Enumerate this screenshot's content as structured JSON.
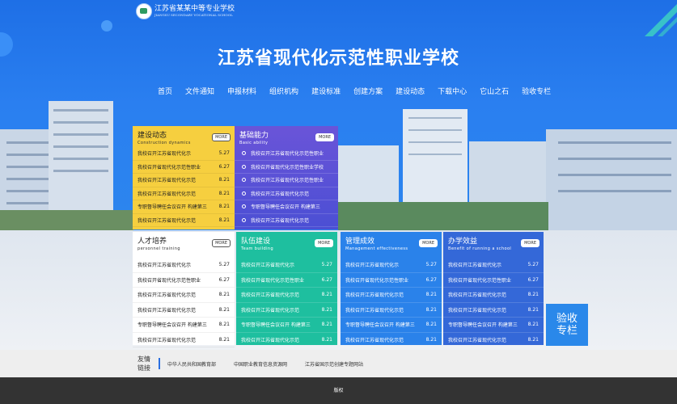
{
  "header": {
    "logo_text": "江苏省某某中等专业学校",
    "logo_sub": "JIANGSU SECONDARY VOCATIONAL SCHOOL",
    "title": "江苏省现代化示范性职业学校"
  },
  "nav": [
    "首页",
    "文件通知",
    "申报材料",
    "组织机构",
    "建设标准",
    "创建方案",
    "建设动态",
    "下载中心",
    "它山之石",
    "验收专栏"
  ],
  "more_label": "MORE",
  "panels": {
    "jianshe": {
      "title": "建设动态",
      "subtitle": "Construction dynamics",
      "items": [
        {
          "text": "我校召开江苏省现代化示",
          "date": "5.27"
        },
        {
          "text": "我校召开省现代化示范性职业",
          "date": "6.27"
        },
        {
          "text": "我校召开江苏省现代化示范",
          "date": "8.21"
        },
        {
          "text": "我校召开江苏省现代化示范",
          "date": "8.21"
        },
        {
          "text": "专职督导聘任会议召开 构建第三",
          "date": "8.21"
        },
        {
          "text": "我校召开江苏省现代化示范",
          "date": "8.21"
        }
      ]
    },
    "jichu": {
      "title": "基础能力",
      "subtitle": "Basic ability",
      "items": [
        "我校召开江苏省现代化示范性职业",
        "我校召开省现代化示范性职业学校",
        "我校召开江苏省现代化示范性职业",
        "我校召开江苏省现代化示范",
        "专职督导聘任会议召开 构建第三",
        "我校召开江苏省现代化示范"
      ]
    },
    "rencai": {
      "title": "人才培养",
      "subtitle": "personnel training",
      "items": [
        {
          "text": "我校召开江苏省现代化示",
          "date": "5.27"
        },
        {
          "text": "我校召开省现代化示范性职业",
          "date": "6.27"
        },
        {
          "text": "我校召开江苏省现代化示范",
          "date": "8.21"
        },
        {
          "text": "我校召开江苏省现代化示范",
          "date": "8.21"
        },
        {
          "text": "专职督导聘任会议召开 构建第三",
          "date": "8.21"
        },
        {
          "text": "我校召开江苏省现代化示范",
          "date": "8.21"
        }
      ]
    },
    "duiwu": {
      "title": "队伍建设",
      "subtitle": "Team building",
      "items": [
        {
          "text": "我校召开江苏省现代化示",
          "date": "5.27"
        },
        {
          "text": "我校召开省现代化示范性职业",
          "date": "6.27"
        },
        {
          "text": "我校召开江苏省现代化示范",
          "date": "8.21"
        },
        {
          "text": "我校召开江苏省现代化示范",
          "date": "8.21"
        },
        {
          "text": "专职督导聘任会议召开 构建第三",
          "date": "8.21"
        },
        {
          "text": "我校召开江苏省现代化示范",
          "date": "8.21"
        }
      ]
    },
    "guanli": {
      "title": "管理成效",
      "subtitle": "Management effectiveness",
      "items": [
        {
          "text": "我校召开江苏省现代化示",
          "date": "5.27"
        },
        {
          "text": "我校召开省现代化示范性职业",
          "date": "6.27"
        },
        {
          "text": "我校召开江苏省现代化示范",
          "date": "8.21"
        },
        {
          "text": "我校召开江苏省现代化示范",
          "date": "8.21"
        },
        {
          "text": "专职督导聘任会议召开 构建第三",
          "date": "8.21"
        },
        {
          "text": "我校召开江苏省现代化示范",
          "date": "8.21"
        }
      ]
    },
    "banxue": {
      "title": "办学效益",
      "subtitle": "Benefit of running a school",
      "items": [
        {
          "text": "我校召开江苏省现代化示",
          "date": "5.27"
        },
        {
          "text": "我校召开省现代化示范性职业",
          "date": "6.27"
        },
        {
          "text": "我校召开江苏省现代化示范",
          "date": "8.21"
        },
        {
          "text": "我校召开江苏省现代化示范",
          "date": "8.21"
        },
        {
          "text": "专职督导聘任会议召开 构建第三",
          "date": "8.21"
        },
        {
          "text": "我校召开江苏省现代化示范",
          "date": "8.21"
        }
      ]
    }
  },
  "yanshou_badge": "验收专栏",
  "friend_links": {
    "label": "友情链接",
    "items": [
      "中华人民共和国教育部",
      "中国职业教育信息资源网",
      "江苏省国示范创建专题网站"
    ]
  },
  "footer": "版权",
  "colors": {
    "hero_blue": "#1e6fe6",
    "yellow": "#f6cf3f",
    "purple": "#5a52d6",
    "green": "#1ebf9f",
    "blue": "#2a82ea",
    "dark_blue": "#3468d8",
    "footer": "#333333"
  }
}
